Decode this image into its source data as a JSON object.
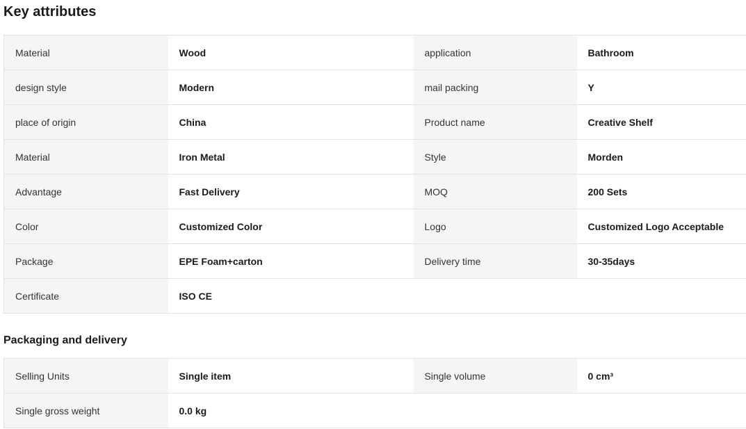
{
  "key_attributes": {
    "title": "Key attributes",
    "rows": [
      {
        "k1": "Material",
        "v1": "Wood",
        "k2": "application",
        "v2": "Bathroom"
      },
      {
        "k1": "design style",
        "v1": "Modern",
        "k2": "mail packing",
        "v2": "Y"
      },
      {
        "k1": "place of origin",
        "v1": "China",
        "k2": "Product name",
        "v2": "Creative Shelf"
      },
      {
        "k1": "Material",
        "v1": "Iron Metal",
        "k2": "Style",
        "v2": "Morden"
      },
      {
        "k1": "Advantage",
        "v1": "Fast Delivery",
        "k2": "MOQ",
        "v2": "200 Sets"
      },
      {
        "k1": "Color",
        "v1": "Customized Color",
        "k2": "Logo",
        "v2": "Customized Logo Acceptable"
      },
      {
        "k1": "Package",
        "v1": "EPE Foam+carton",
        "k2": "Delivery time",
        "v2": "30-35days"
      },
      {
        "k1": "Certificate",
        "v1": "ISO CE",
        "k2": "",
        "v2": ""
      }
    ]
  },
  "packaging_delivery": {
    "title": "Packaging and delivery",
    "rows": [
      {
        "k1": "Selling Units",
        "v1": "Single item",
        "k2": "Single volume",
        "v2": "0 cm³"
      },
      {
        "k1": "Single gross weight",
        "v1": "0.0 kg",
        "k2": "",
        "v2": ""
      }
    ]
  }
}
